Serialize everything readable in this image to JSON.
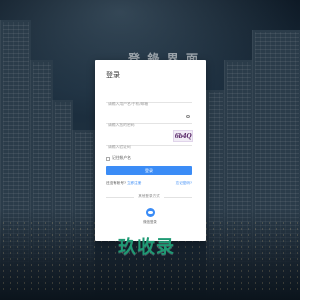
{
  "background": {
    "behind_brand": "登 錄 界 面"
  },
  "login": {
    "title": "登录",
    "username_placeholder": "请输入用户名/手机/邮箱",
    "password_placeholder": "请输入您的密码",
    "captcha_placeholder": "请输入验证码",
    "captcha_text": "6b4Q",
    "remember_label": "记住帐户名",
    "login_button": "登录",
    "no_account_text": "还没有帐号?",
    "register_link": "立即注册",
    "forgot_link": "忘记密码?",
    "other_login": "其他登录方式",
    "third_party_label": "微信登录",
    "accent_color": "#3b8cf6"
  },
  "watermark": {
    "text": "玖收录"
  }
}
